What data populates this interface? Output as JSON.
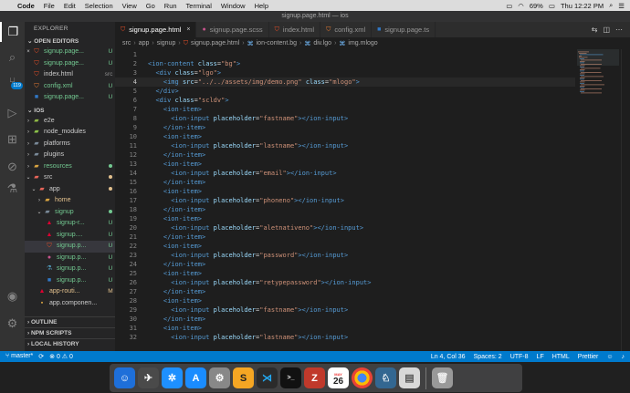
{
  "menubar": {
    "items": [
      "Code",
      "File",
      "Edit",
      "Selection",
      "View",
      "Go",
      "Run",
      "Terminal",
      "Window",
      "Help"
    ],
    "battery": "69%",
    "clock": "Thu 12:22 PM"
  },
  "window_title": "signup.page.html — ios",
  "activity": {
    "badge": "119"
  },
  "sidebar": {
    "title": "EXPLORER",
    "open_editors_header": "OPEN EDITORS",
    "open_editors": [
      {
        "name": "signup.page...",
        "status": "U",
        "close": "×"
      },
      {
        "name": "signup.page...",
        "status": "U"
      },
      {
        "name": "index.html",
        "status": "src"
      },
      {
        "name": "config.xml",
        "status": "U"
      },
      {
        "name": "signup.page...",
        "status": "U"
      }
    ],
    "project_header": "IOS",
    "tree": [
      {
        "name": "e2e"
      },
      {
        "name": "node_modules"
      },
      {
        "name": "platforms"
      },
      {
        "name": "plugins"
      },
      {
        "name": "resources"
      },
      {
        "name": "src"
      },
      {
        "name": "app"
      },
      {
        "name": "home"
      },
      {
        "name": "signup"
      },
      {
        "name": "signup-r...",
        "status": "U"
      },
      {
        "name": "signup....",
        "status": "U"
      },
      {
        "name": "signup.p...",
        "status": "U"
      },
      {
        "name": "signup.p...",
        "status": "U"
      },
      {
        "name": "signup.p...",
        "status": "U"
      },
      {
        "name": "signup.p...",
        "status": "U"
      },
      {
        "name": "app-routi...",
        "status": "M"
      },
      {
        "name": "app.componen..."
      }
    ],
    "outline": "OUTLINE",
    "npm": "NPM SCRIPTS",
    "history": "LOCAL HISTORY"
  },
  "tabs": [
    {
      "label": "signup.page.html",
      "active": true
    },
    {
      "label": "signup.page.scss"
    },
    {
      "label": "index.html"
    },
    {
      "label": "config.xml"
    },
    {
      "label": "signup.page.ts"
    }
  ],
  "breadcrumb": [
    "src",
    "app",
    "signup",
    "signup.page.html",
    "ion-content.bg",
    "div.lgo",
    "img.mlogo"
  ],
  "code": {
    "current_line": 4,
    "lines": [
      {
        "n": "1",
        "parts": []
      },
      {
        "n": "2",
        "parts": [
          [
            "tag",
            "<ion-content "
          ],
          [
            "attr",
            "class"
          ],
          [
            "eq",
            "="
          ],
          [
            "str",
            "\"bg\""
          ],
          [
            "tag",
            ">"
          ]
        ]
      },
      {
        "n": "3",
        "parts": [
          [
            "i",
            "  "
          ],
          [
            "tag",
            "<div "
          ],
          [
            "attr",
            "class"
          ],
          [
            "eq",
            "="
          ],
          [
            "str",
            "\"lgo\""
          ],
          [
            "tag",
            ">"
          ]
        ]
      },
      {
        "n": "4",
        "parts": [
          [
            "i",
            "    "
          ],
          [
            "tag",
            "<img "
          ],
          [
            "attr",
            "src"
          ],
          [
            "eq",
            "="
          ],
          [
            "str",
            "\"../../assets/img/demo.png\""
          ],
          [
            "eq",
            " "
          ],
          [
            "attr",
            "class"
          ],
          [
            "eq",
            "="
          ],
          [
            "str",
            "\"mlogo\""
          ],
          [
            "tag",
            ">"
          ]
        ]
      },
      {
        "n": "5",
        "parts": [
          [
            "i",
            "  "
          ],
          [
            "tag",
            "</div>"
          ]
        ]
      },
      {
        "n": "6",
        "parts": [
          [
            "i",
            "  "
          ],
          [
            "tag",
            "<div "
          ],
          [
            "attr",
            "class"
          ],
          [
            "eq",
            "="
          ],
          [
            "str",
            "\"scldv\""
          ],
          [
            "tag",
            ">"
          ]
        ]
      },
      {
        "n": "7",
        "parts": [
          [
            "i",
            "    "
          ],
          [
            "tag",
            "<ion-item>"
          ]
        ]
      },
      {
        "n": "8",
        "parts": [
          [
            "i",
            "      "
          ],
          [
            "tag",
            "<ion-input "
          ],
          [
            "attr",
            "placeholder"
          ],
          [
            "eq",
            "="
          ],
          [
            "str",
            "\"fastname\""
          ],
          [
            "tag",
            "></ion-input>"
          ]
        ]
      },
      {
        "n": "9",
        "parts": [
          [
            "i",
            "    "
          ],
          [
            "tag",
            "</ion-item>"
          ]
        ]
      },
      {
        "n": "10",
        "parts": [
          [
            "i",
            "    "
          ],
          [
            "tag",
            "<ion-item>"
          ]
        ]
      },
      {
        "n": "11",
        "parts": [
          [
            "i",
            "      "
          ],
          [
            "tag",
            "<ion-input "
          ],
          [
            "attr",
            "placeholder"
          ],
          [
            "eq",
            "="
          ],
          [
            "str",
            "\"lastname\""
          ],
          [
            "tag",
            "></ion-input>"
          ]
        ]
      },
      {
        "n": "12",
        "parts": [
          [
            "i",
            "    "
          ],
          [
            "tag",
            "</ion-item>"
          ]
        ]
      },
      {
        "n": "13",
        "parts": [
          [
            "i",
            "    "
          ],
          [
            "tag",
            "<ion-item>"
          ]
        ]
      },
      {
        "n": "14",
        "parts": [
          [
            "i",
            "      "
          ],
          [
            "tag",
            "<ion-input "
          ],
          [
            "attr",
            "placeholder"
          ],
          [
            "eq",
            "="
          ],
          [
            "str",
            "\"email\""
          ],
          [
            "tag",
            "></ion-input>"
          ]
        ]
      },
      {
        "n": "15",
        "parts": [
          [
            "i",
            "    "
          ],
          [
            "tag",
            "</ion-item>"
          ]
        ]
      },
      {
        "n": "16",
        "parts": [
          [
            "i",
            "    "
          ],
          [
            "tag",
            "<ion-item>"
          ]
        ]
      },
      {
        "n": "17",
        "parts": [
          [
            "i",
            "      "
          ],
          [
            "tag",
            "<ion-input "
          ],
          [
            "attr",
            "placeholder"
          ],
          [
            "eq",
            "="
          ],
          [
            "str",
            "\"phoneno\""
          ],
          [
            "tag",
            "></ion-input>"
          ]
        ]
      },
      {
        "n": "18",
        "parts": [
          [
            "i",
            "    "
          ],
          [
            "tag",
            "</ion-item>"
          ]
        ]
      },
      {
        "n": "19",
        "parts": [
          [
            "i",
            "    "
          ],
          [
            "tag",
            "<ion-item>"
          ]
        ]
      },
      {
        "n": "20",
        "parts": [
          [
            "i",
            "      "
          ],
          [
            "tag",
            "<ion-input "
          ],
          [
            "attr",
            "placeholder"
          ],
          [
            "eq",
            "="
          ],
          [
            "str",
            "\"aletnativeno\""
          ],
          [
            "tag",
            "></ion-input>"
          ]
        ]
      },
      {
        "n": "21",
        "parts": [
          [
            "i",
            "    "
          ],
          [
            "tag",
            "</ion-item>"
          ]
        ]
      },
      {
        "n": "22",
        "parts": [
          [
            "i",
            "    "
          ],
          [
            "tag",
            "<ion-item>"
          ]
        ]
      },
      {
        "n": "23",
        "parts": [
          [
            "i",
            "      "
          ],
          [
            "tag",
            "<ion-input "
          ],
          [
            "attr",
            "placeholder"
          ],
          [
            "eq",
            "="
          ],
          [
            "str",
            "\"password\""
          ],
          [
            "tag",
            "></ion-input>"
          ]
        ]
      },
      {
        "n": "24",
        "parts": [
          [
            "i",
            "    "
          ],
          [
            "tag",
            "</ion-item>"
          ]
        ]
      },
      {
        "n": "25",
        "parts": [
          [
            "i",
            "    "
          ],
          [
            "tag",
            "<ion-item>"
          ]
        ]
      },
      {
        "n": "26",
        "parts": [
          [
            "i",
            "      "
          ],
          [
            "tag",
            "<ion-input "
          ],
          [
            "attr",
            "placeholder"
          ],
          [
            "eq",
            "="
          ],
          [
            "str",
            "\"retypepassword\""
          ],
          [
            "tag",
            "></ion-input>"
          ]
        ]
      },
      {
        "n": "27",
        "parts": [
          [
            "i",
            "    "
          ],
          [
            "tag",
            "</ion-item>"
          ]
        ]
      },
      {
        "n": "28",
        "parts": [
          [
            "i",
            "    "
          ],
          [
            "tag",
            "<ion-item>"
          ]
        ]
      },
      {
        "n": "29",
        "parts": [
          [
            "i",
            "      "
          ],
          [
            "tag",
            "<ion-input "
          ],
          [
            "attr",
            "placeholder"
          ],
          [
            "eq",
            "="
          ],
          [
            "str",
            "\"fastname\""
          ],
          [
            "tag",
            "></ion-input>"
          ]
        ]
      },
      {
        "n": "30",
        "parts": [
          [
            "i",
            "    "
          ],
          [
            "tag",
            "</ion-item>"
          ]
        ]
      },
      {
        "n": "31",
        "parts": [
          [
            "i",
            "    "
          ],
          [
            "tag",
            "<ion-item>"
          ]
        ]
      },
      {
        "n": "32",
        "parts": [
          [
            "i",
            "      "
          ],
          [
            "tag",
            "<ion-input "
          ],
          [
            "attr",
            "placeholder"
          ],
          [
            "eq",
            "="
          ],
          [
            "str",
            "\"lastname\""
          ],
          [
            "tag",
            "></ion-input>"
          ]
        ]
      }
    ]
  },
  "statusbar": {
    "branch": "master*",
    "sync": "⟳",
    "problems": "⊗ 0 ⚠ 0",
    "position": "Ln 4, Col 36",
    "spaces": "Spaces: 2",
    "encoding": "UTF-8",
    "eol": "LF",
    "language": "HTML",
    "formatter": "Prettier"
  },
  "dock": {
    "calendar_month": "MAY",
    "calendar_day": "26"
  },
  "colors": {
    "accent": "#007acc",
    "tag": "#569cd6",
    "attr": "#9cdcfe",
    "string": "#ce9178",
    "untracked": "#73c991",
    "modified": "#e2c08d"
  }
}
